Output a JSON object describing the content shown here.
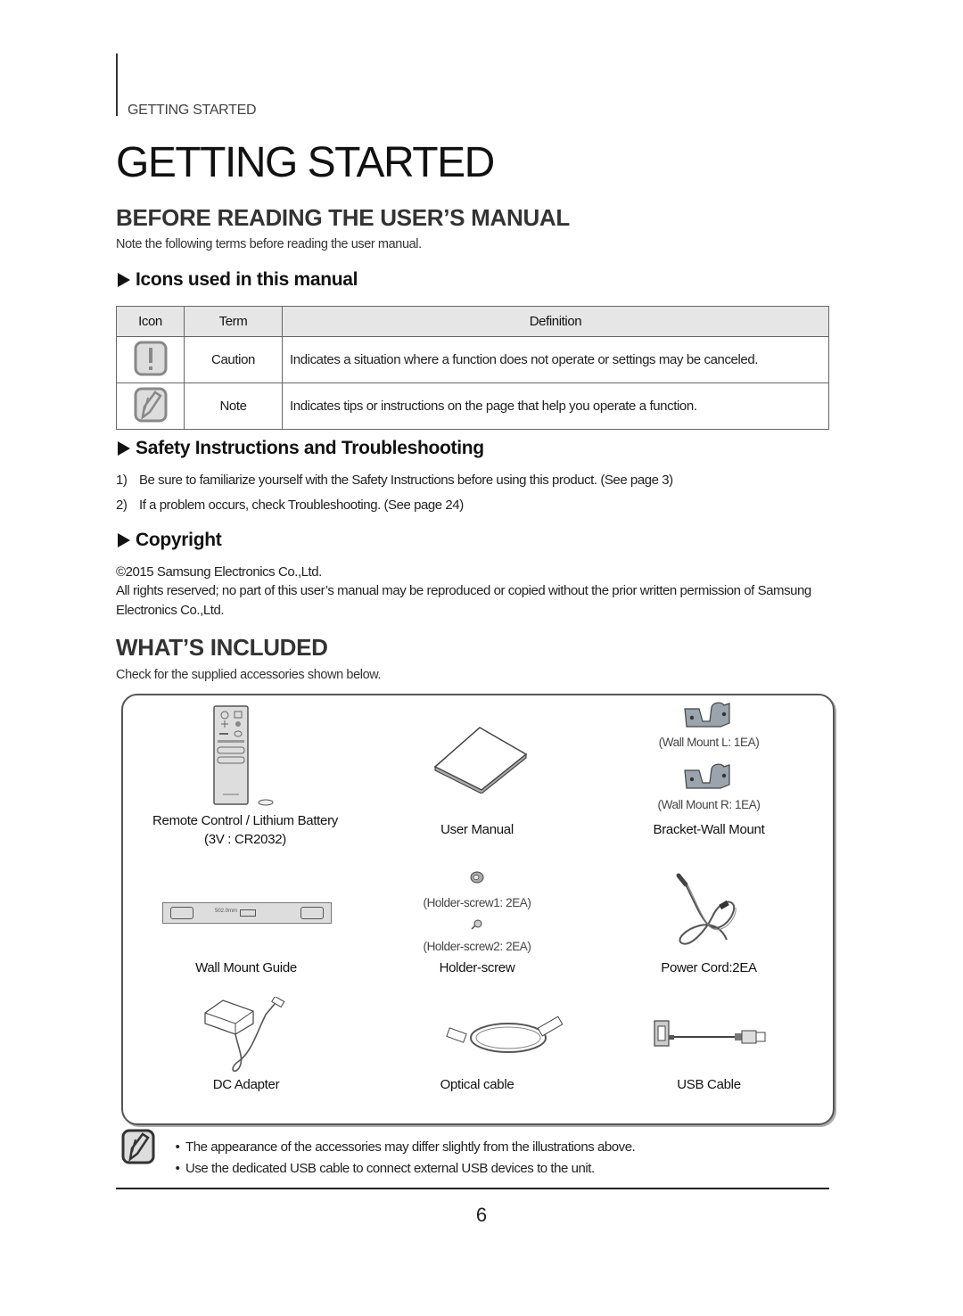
{
  "header": {
    "section_tag": "GETTING STARTED",
    "page_title": "GETTING STARTED"
  },
  "before_reading": {
    "heading": "BEFORE READING THE USER’S MANUAL",
    "intro": "Note the following terms before reading the user manual.",
    "icons_section": {
      "heading": "Icons used in this manual",
      "columns": [
        "Icon",
        "Term",
        "Definition"
      ],
      "rows": [
        {
          "icon": "caution-icon",
          "term": "Caution",
          "definition": "Indicates a situation where a function does not operate or settings may be canceled."
        },
        {
          "icon": "note-icon",
          "term": "Note",
          "definition": "Indicates tips or instructions on the page that help you operate a function."
        }
      ]
    },
    "safety_section": {
      "heading": "Safety Instructions and Troubleshooting",
      "items": [
        {
          "num": "1)",
          "text": "Be sure to familiarize yourself with the Safety Instructions before using this product. (See page 3)"
        },
        {
          "num": "2)",
          "text": "If a problem occurs, check Troubleshooting. (See page 24)"
        }
      ]
    },
    "copyright_section": {
      "heading": "Copyright",
      "line1": "©2015 Samsung Electronics Co.,Ltd.",
      "line2": "All rights reserved; no part of this user’s manual may be reproduced or copied without the prior written permission of Samsung Electronics Co.,Ltd."
    }
  },
  "whats_included": {
    "heading": "WHAT’S INCLUDED",
    "intro": "Check for the supplied accessories shown below.",
    "items": {
      "remote": {
        "label1": "Remote Control / Lithium Battery",
        "label2": "(3V : CR2032)"
      },
      "manual": {
        "label": "User Manual"
      },
      "bracket": {
        "sub1": "(Wall Mount L: 1EA)",
        "sub2": "(Wall Mount R: 1EA)",
        "label": "Bracket-Wall Mount"
      },
      "guide": {
        "label": "Wall Mount Guide",
        "dimension": "502.0mm"
      },
      "holder": {
        "sub1": "(Holder-screw1: 2EA)",
        "sub2": "(Holder-screw2: 2EA)",
        "label": "Holder-screw"
      },
      "power": {
        "label": "Power Cord:2EA"
      },
      "dc": {
        "label": "DC Adapter"
      },
      "optical": {
        "label": "Optical cable"
      },
      "usb": {
        "label": "USB Cable"
      }
    },
    "notes": [
      "The appearance of the accessories may differ slightly from the illustrations above.",
      "Use the dedicated USB cable to connect external USB devices to the unit."
    ],
    "bullet": "•"
  },
  "footer": {
    "page_number": "6"
  }
}
